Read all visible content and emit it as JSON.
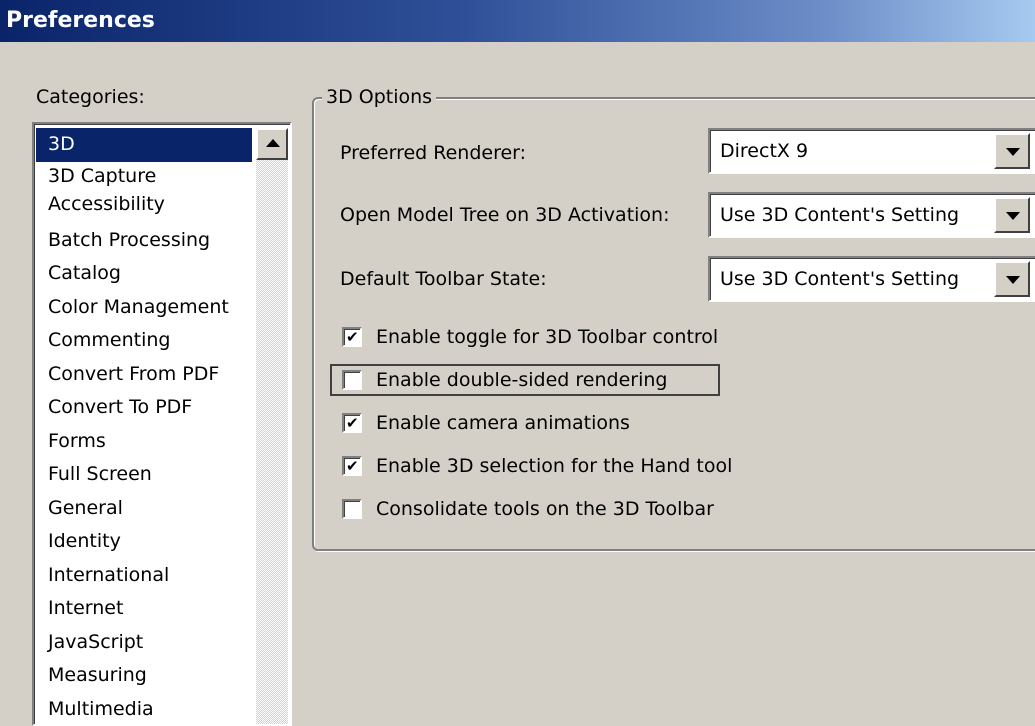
{
  "window": {
    "title": "Preferences"
  },
  "categories": {
    "label": "Categories:",
    "items": [
      "3D",
      "3D Capture",
      "Accessibility",
      "Batch Processing",
      "Catalog",
      "Color Management",
      "Commenting",
      "Convert From PDF",
      "Convert To PDF",
      "Forms",
      "Full Screen",
      "General",
      "Identity",
      "International",
      "Internet",
      "JavaScript",
      "Measuring",
      "Multimedia"
    ],
    "selected": "3D"
  },
  "options": {
    "group_title": "3D Options",
    "preferred_renderer": {
      "label": "Preferred Renderer:",
      "value": "DirectX 9"
    },
    "open_model_tree": {
      "label": "Open Model Tree on 3D Activation:",
      "value": "Use 3D Content's Setting"
    },
    "default_toolbar_state": {
      "label": "Default Toolbar State:",
      "value": "Use 3D Content's Setting"
    },
    "checkboxes": [
      {
        "label": "Enable toggle for 3D Toolbar control",
        "checked": true
      },
      {
        "label": "Enable double-sided rendering",
        "checked": false
      },
      {
        "label": "Enable camera animations",
        "checked": true
      },
      {
        "label": "Enable 3D selection for the Hand tool",
        "checked": true
      },
      {
        "label": "Consolidate tools on the 3D Toolbar",
        "checked": false
      }
    ]
  },
  "colors": {
    "selection": "#0a246a",
    "dialog_background": "#d4d0c8"
  }
}
